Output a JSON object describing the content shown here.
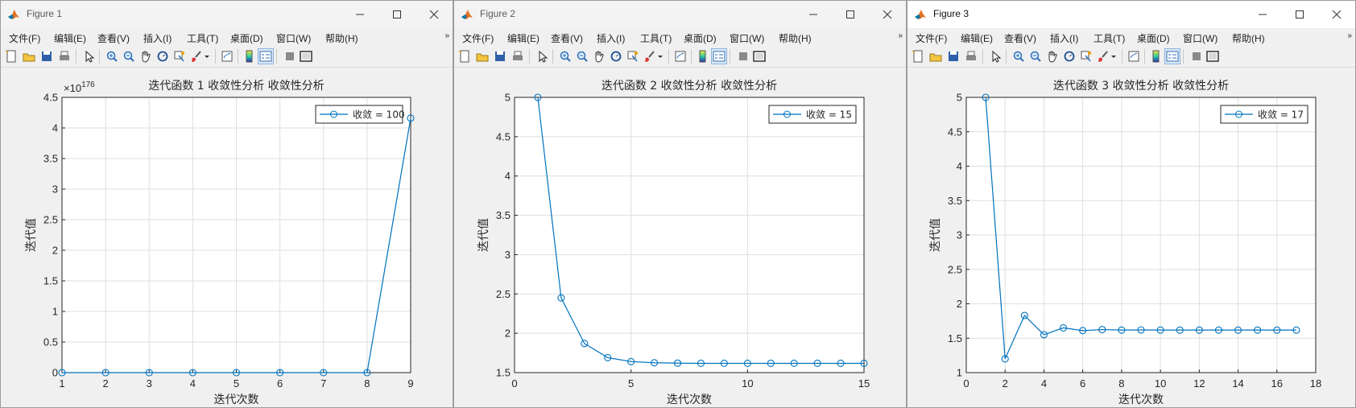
{
  "menu": [
    "文件(F)",
    "编辑(E)",
    "查看(V)",
    "插入(I)",
    "工具(T)",
    "桌面(D)",
    "窗口(W)",
    "帮助(H)"
  ],
  "menu_more": "»",
  "toolbar_icons": [
    "new-figure-icon",
    "open-icon",
    "save-icon",
    "print-icon",
    "pointer-icon",
    "zoom-in-icon",
    "zoom-out-icon",
    "pan-icon",
    "rotate-3d-icon",
    "data-cursor-icon",
    "brush-icon",
    "brush-dropdown-icon",
    "link-plot-icon",
    "colorbar-icon",
    "legend-icon",
    "hide-plot-tools-icon",
    "show-plot-tools-icon"
  ],
  "colors": {
    "line": "#0072bd",
    "grid": "#dfdfdf",
    "axes_bg": "#ffffff",
    "figure_bg": "#f0f0f0"
  },
  "windows": [
    {
      "title": "Figure 1",
      "active": false
    },
    {
      "title": "Figure 2",
      "active": false
    },
    {
      "title": "Figure 3",
      "active": true
    }
  ],
  "chart_data": [
    {
      "type": "line",
      "title": "迭代函数 1 收敛性分析 收敛性分析",
      "xlabel": "迭代次数",
      "ylabel": "迭代值",
      "y_exponent_label": "×10",
      "y_exponent": "176",
      "xlim": [
        1,
        9
      ],
      "ylim": [
        0,
        4.5
      ],
      "xticks": [
        "1",
        "2",
        "3",
        "4",
        "5",
        "6",
        "7",
        "8",
        "9"
      ],
      "yticks": [
        "0",
        "0.5",
        "1",
        "1.5",
        "2",
        "2.5",
        "3",
        "3.5",
        "4",
        "4.5"
      ],
      "grid": true,
      "legend_position": "top-right",
      "series": [
        {
          "name": "收敛 = 100",
          "marker": "circle",
          "x": [
            1,
            2,
            3,
            4,
            5,
            6,
            7,
            8,
            9
          ],
          "y": [
            0,
            0,
            0,
            0,
            0,
            0,
            0,
            0,
            4.16
          ]
        }
      ]
    },
    {
      "type": "line",
      "title": "迭代函数 2 收敛性分析 收敛性分析",
      "xlabel": "迭代次数",
      "ylabel": "迭代值",
      "xlim": [
        0,
        15
      ],
      "ylim": [
        1.5,
        5
      ],
      "xticks": [
        "0",
        "5",
        "10",
        "15"
      ],
      "yticks": [
        "1.5",
        "2",
        "2.5",
        "3",
        "3.5",
        "4",
        "4.5",
        "5"
      ],
      "grid": true,
      "legend_position": "top-right",
      "series": [
        {
          "name": "收敛 = 15",
          "marker": "circle",
          "x": [
            1,
            2,
            3,
            4,
            5,
            6,
            7,
            8,
            9,
            10,
            11,
            12,
            13,
            14,
            15
          ],
          "y": [
            5,
            2.45,
            1.87,
            1.69,
            1.64,
            1.625,
            1.62,
            1.618,
            1.618,
            1.618,
            1.618,
            1.618,
            1.618,
            1.618,
            1.618
          ]
        }
      ]
    },
    {
      "type": "line",
      "title": "迭代函数 3 收敛性分析 收敛性分析",
      "xlabel": "迭代次数",
      "ylabel": "迭代值",
      "xlim": [
        0,
        18
      ],
      "ylim": [
        1,
        5
      ],
      "xticks": [
        "0",
        "2",
        "4",
        "6",
        "8",
        "10",
        "12",
        "14",
        "16",
        "18"
      ],
      "yticks": [
        "1",
        "1.5",
        "2",
        "2.5",
        "3",
        "3.5",
        "4",
        "4.5",
        "5"
      ],
      "grid": true,
      "legend_position": "top-right",
      "series": [
        {
          "name": "收敛 = 17",
          "marker": "circle",
          "x": [
            1,
            2,
            3,
            4,
            5,
            6,
            7,
            8,
            9,
            10,
            11,
            12,
            13,
            14,
            15,
            16,
            17
          ],
          "y": [
            5,
            1.2,
            1.83,
            1.55,
            1.65,
            1.61,
            1.625,
            1.618,
            1.62,
            1.618,
            1.618,
            1.618,
            1.618,
            1.618,
            1.618,
            1.618,
            1.618
          ]
        }
      ]
    }
  ]
}
